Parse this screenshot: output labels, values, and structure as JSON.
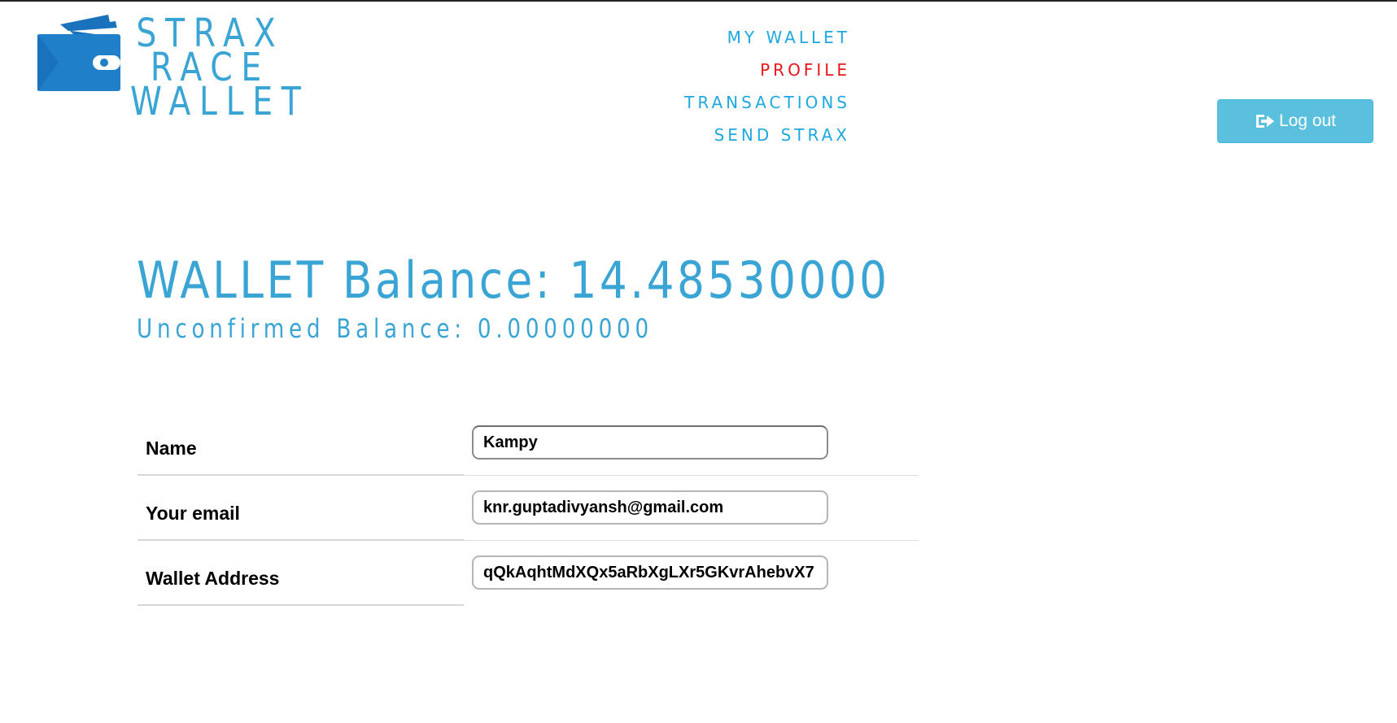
{
  "brand": {
    "line1": "STRAX",
    "line2": "RACE",
    "line3": "WALLET",
    "icon": "wallet-icon"
  },
  "nav": {
    "items": [
      {
        "label": "MY WALLET",
        "active": false
      },
      {
        "label": "PROFILE",
        "active": true
      },
      {
        "label": "TRANSACTIONS",
        "active": false
      },
      {
        "label": "SEND STRAX",
        "active": false
      }
    ]
  },
  "logout": {
    "label": "Log out",
    "icon": "log-out-icon"
  },
  "wallet": {
    "balance_text": "WALLET Balance: 14.48530000",
    "unconfirmed_text": "Unconfirmed Balance: 0.00000000"
  },
  "profile": {
    "rows": [
      {
        "label": "Name",
        "value": "Kampy"
      },
      {
        "label": "Your email",
        "value": "knr.guptadivyansh@gmail.com"
      },
      {
        "label": "Wallet Address",
        "value": "qQkAqhtMdXQx5aRbXgLXr5GKvrAhebvX7"
      }
    ]
  },
  "colors": {
    "brand_blue": "#3aa5d4",
    "nav_blue": "#1fa8df",
    "nav_active": "#e8161b",
    "button_bg": "#5bc0de"
  }
}
